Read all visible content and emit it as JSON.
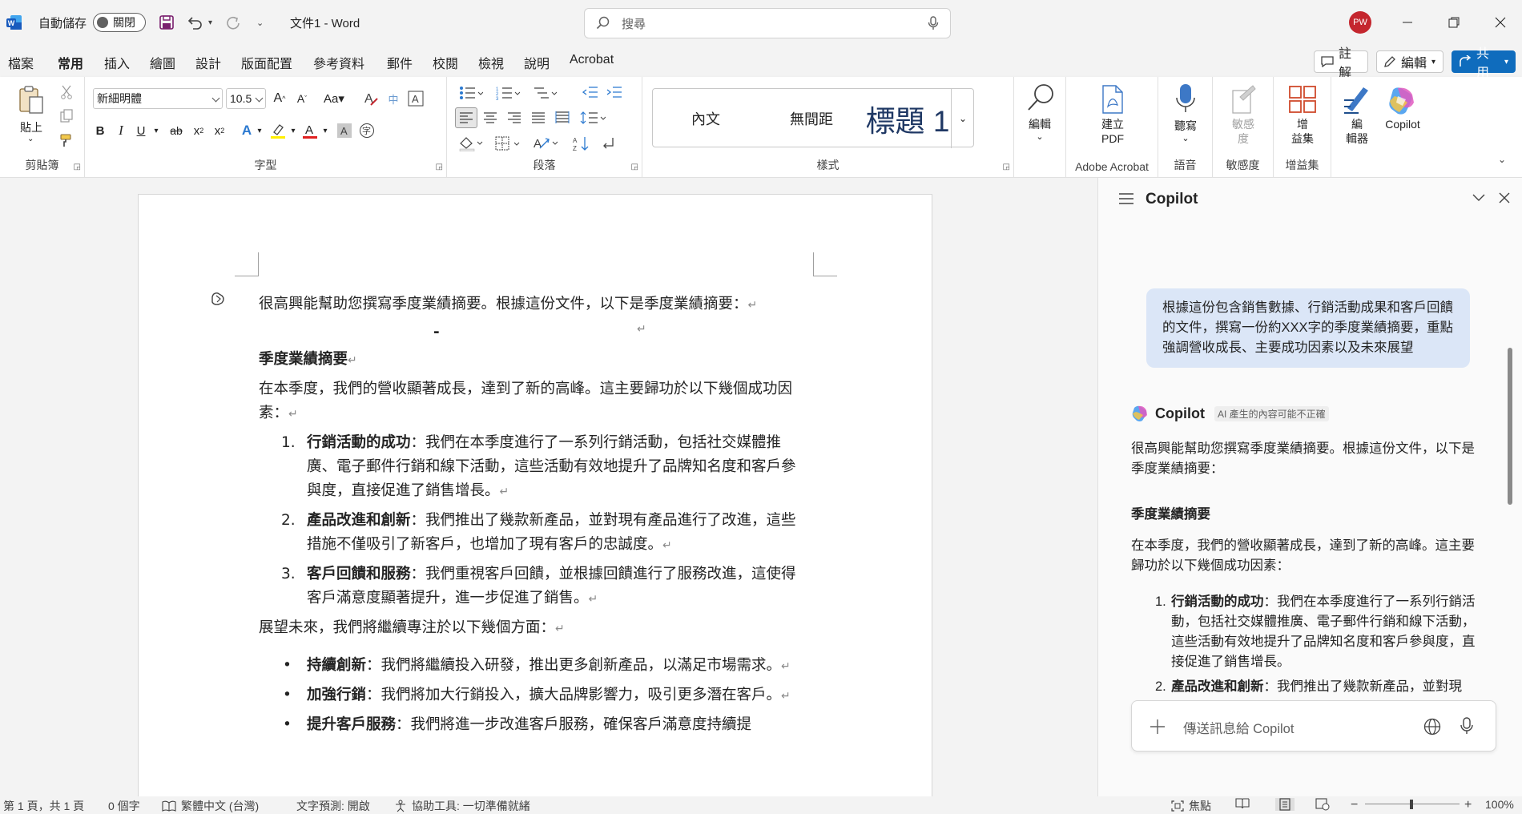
{
  "titlebar": {
    "autosave_label": "自動儲存",
    "autosave_state": "關閉",
    "doc_title": "文件1  -  Word",
    "search_placeholder": "搜尋",
    "avatar_initials": "PW"
  },
  "menu": {
    "tabs": [
      "檔案",
      "常用",
      "插入",
      "繪圖",
      "設計",
      "版面配置",
      "參考資料",
      "郵件",
      "校閱",
      "檢視",
      "說明",
      "Acrobat"
    ],
    "active_tab": "常用",
    "comments_label": "註解",
    "editing_label": "編輯",
    "share_label": "共用"
  },
  "ribbon": {
    "clipboard": {
      "paste_label": "貼上",
      "group_label": "剪貼簿"
    },
    "font": {
      "font_name": "新細明體",
      "font_size": "10.5",
      "group_label": "字型"
    },
    "paragraph": {
      "group_label": "段落"
    },
    "styles": {
      "items": [
        "內文",
        "無間距",
        "標題 1"
      ],
      "group_label": "樣式"
    },
    "editing": {
      "label": "編輯"
    },
    "acrobat": {
      "create_pdf": "建立\nPDF",
      "group_label": "Adobe Acrobat"
    },
    "voice": {
      "dictate": "聽寫",
      "group_label": "語音"
    },
    "sensitivity": {
      "label": "敏感\n度",
      "group_label": "敏感度"
    },
    "addins": {
      "label": "增\n益集",
      "group_label": "增益集"
    },
    "editor": {
      "label": "編\n輯器"
    },
    "copilot": {
      "label": "Copilot"
    }
  },
  "document": {
    "intro": "很高興能幫助您撰寫季度業績摘要。根據這份文件，以下是季度業績摘要：",
    "dash": "-",
    "heading": "季度業績摘要",
    "para1": "在本季度，我們的營收顯著成長，達到了新的高峰。這主要歸功於以下幾個成功因素：",
    "ordered": [
      {
        "num": "1.",
        "bold": "行銷活動的成功",
        "text": "：我們在本季度進行了一系列行銷活動，包括社交媒體推廣、電子郵件行銷和線下活動，這些活動有效地提升了品牌知名度和客戶參與度，直接促進了銷售增長。"
      },
      {
        "num": "2.",
        "bold": "產品改進和創新",
        "text": "：我們推出了幾款新產品，並對現有產品進行了改進，這些措施不僅吸引了新客戶，也增加了現有客戶的忠誠度。"
      },
      {
        "num": "3.",
        "bold": "客戶回饋和服務",
        "text": "：我們重視客戶回饋，並根據回饋進行了服務改進，這使得客戶滿意度顯著提升，進一步促進了銷售。"
      }
    ],
    "para2": "展望未來，我們將繼續專注於以下幾個方面：",
    "bullets": [
      {
        "bold": "持續創新",
        "text": "：我們將繼續投入研發，推出更多創新產品，以滿足市場需求。"
      },
      {
        "bold": "加強行銷",
        "text": "：我們將加大行銷投入，擴大品牌影響力，吸引更多潛在客戶。"
      },
      {
        "bold": "提升客戶服務",
        "text": "：我們將進一步改進客戶服務，確保客戶滿意度持續提"
      }
    ],
    "para_mark": "↵"
  },
  "copilot": {
    "title": "Copilot",
    "user_prompt": "根據這份包含銷售數據、行銷活動成果和客戶回饋的文件，撰寫一份約XXX字的季度業績摘要，重點強調營收成長、主要成功因素以及未來展望",
    "bot_name": "Copilot",
    "disclaimer": "AI 產生的內容可能不正確",
    "response_intro": "很高興能幫助您撰寫季度業績摘要。根據這份文件，以下是季度業績摘要：",
    "response_heading": "季度業績摘要",
    "response_para": "在本季度，我們的營收顯著成長，達到了新的高峰。這主要歸功於以下幾個成功因素：",
    "response_items": [
      {
        "bold": "行銷活動的成功",
        "text": "：我們在本季度進行了一系列行銷活動，包括社交媒體推廣、電子郵件行銷和線下活動，這些活動有效地提升了品牌知名度和客戶參與度，直接促進了銷售增長。"
      },
      {
        "bold": "產品改進和創新",
        "text": "：我們推出了幾款新產品，並對現"
      }
    ],
    "input_placeholder": "傳送訊息給 Copilot"
  },
  "statusbar": {
    "page": "第 1 頁，共 1 頁",
    "words": "0 個字",
    "language": "繁體中文 (台灣)",
    "prediction": "文字預測: 開啟",
    "accessibility": "協助工具: 一切準備就緒",
    "focus": "焦點",
    "zoom": "100%"
  }
}
